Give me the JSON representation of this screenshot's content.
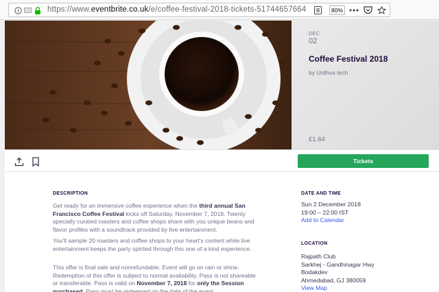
{
  "browser": {
    "url_prefix": "https://www.",
    "url_host": "eventbrite.co.uk",
    "url_path": "/e/coffee-festival-2018-tickets-51744657664",
    "zoom": "80%"
  },
  "event": {
    "month": "DEC",
    "day": "02",
    "title": "Coffee Festival 2018",
    "organizer": "by Urdhva tech",
    "price": "£1.64"
  },
  "actions": {
    "tickets_label": "Tickets"
  },
  "description": {
    "heading": "DESCRIPTION",
    "p1": [
      {
        "t": "Get ready for an immersive coffee experience when the "
      },
      {
        "t": "third annual San Francisco Coffee Festival",
        "b": true
      },
      {
        "t": " kicks off Saturday, November 7, 2018. Twenty specially curated roasters and coffee shops share with you unique beans and flavor profiles with a soundtrack provided by live entertainment."
      }
    ],
    "p2": [
      {
        "t": "You'll sample 20 roasters and coffee shops to your heart's content while live entertainment keeps the party spirited through this one of a kind experience."
      }
    ],
    "p3": [
      {
        "t": "This offer is final sale and nonrefundable. Event will go on rain or shine. Redemption of this offer is subject to normal availability. Pass is not shareable or transferable. Pass is valid on "
      },
      {
        "t": "November 7, 2018",
        "b": true
      },
      {
        "t": " for "
      },
      {
        "t": "only the Session purchased",
        "b": true
      },
      {
        "t": ". Pass must be redeemed on the date of the event"
      }
    ]
  },
  "date_time": {
    "heading": "DATE AND TIME",
    "date": "Sun 2 December 2018",
    "time": "19:00 – 22:00 IST",
    "add_link": "Add to Calendar"
  },
  "location": {
    "heading": "LOCATION",
    "line1": "Rajpath Club",
    "line2": "Sarkhej - Gandhinagar Hwy",
    "line3": "Bodakdev",
    "line4": "Ahmedabad, GJ 380059",
    "map_link": "View Map"
  }
}
